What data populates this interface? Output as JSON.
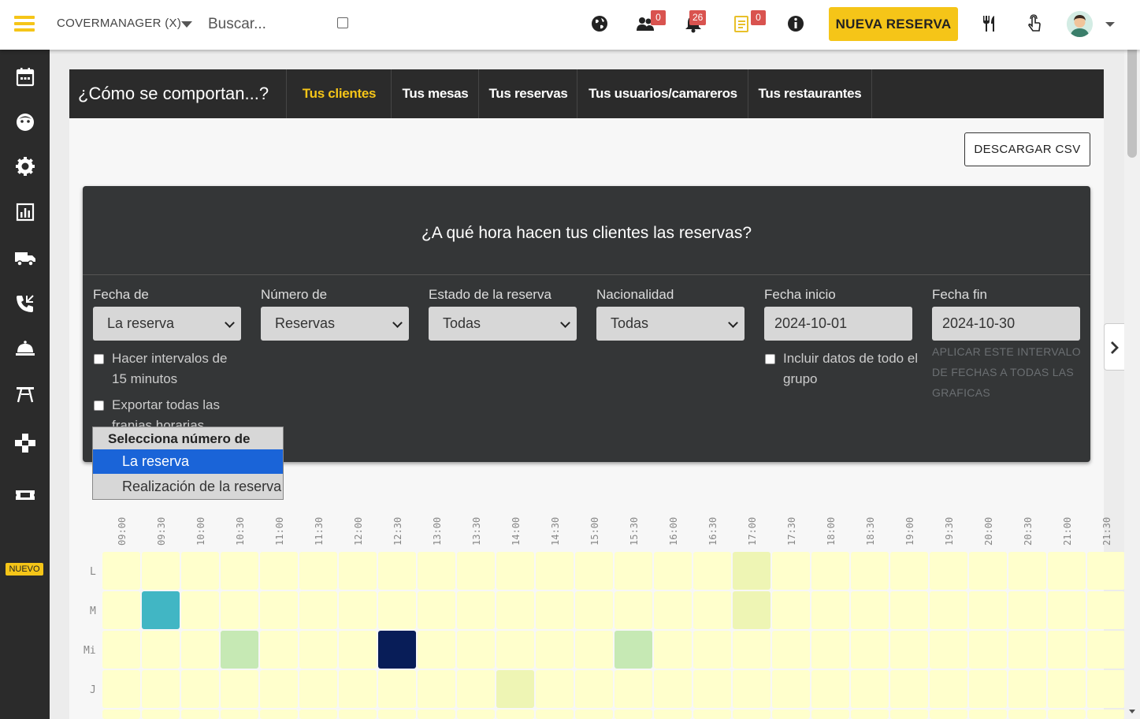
{
  "topbar": {
    "brand": "COVERMANAGER (X)",
    "search_placeholder": "Buscar...",
    "badges": {
      "people": "0",
      "bell": "26",
      "notes": "0"
    },
    "new_reservation": "NUEVA RESERVA"
  },
  "sidebar": {
    "items": [
      "calendar-icon",
      "face-icon",
      "gear-icon",
      "chart-icon",
      "truck-icon",
      "phone-icon",
      "cloche-icon",
      "table-icon",
      "gamepad-icon",
      "ticket-icon"
    ],
    "new_badge": "NUEVO"
  },
  "tabs": {
    "title": "¿Cómo se comportan...?",
    "items": [
      {
        "label": "Tus clientes",
        "active": true
      },
      {
        "label": "Tus mesas",
        "active": false
      },
      {
        "label": "Tus reservas",
        "active": false
      },
      {
        "label": "Tus usuarios/camareros",
        "active": false
      },
      {
        "label": "Tus restaurantes",
        "active": false
      }
    ]
  },
  "download_csv": "DESCARGAR CSV",
  "panel": {
    "title": "¿A qué hora hacen tus clientes las reservas?",
    "filters": {
      "fecha_de": {
        "label": "Fecha de",
        "value": "La reserva"
      },
      "numero_de": {
        "label": "Número de",
        "value": "Reservas"
      },
      "estado": {
        "label": "Estado de la reserva",
        "value": "Todas"
      },
      "nacionalidad": {
        "label": "Nacionalidad",
        "value": "Todas"
      },
      "fecha_inicio": {
        "label": "Fecha inicio",
        "value": "2024-10-01"
      },
      "fecha_fin": {
        "label": "Fecha fin",
        "value": "2024-10-30"
      }
    },
    "checkbox_intervals": "Hacer intervalos de 15 minutos",
    "checkbox_export": "Exportar todas las franjas horarias",
    "checkbox_group": "Incluir datos de todo el grupo",
    "apply_all": "APLICAR ESTE INTERVALO DE FECHAS A TODAS LAS GRAFICAS"
  },
  "dropdown": {
    "header": "Selecciona número de",
    "options": [
      {
        "label": "La reserva",
        "selected": true
      },
      {
        "label": "Realización de la reserva",
        "selected": false
      }
    ]
  },
  "chart_data": {
    "type": "heatmap",
    "x": [
      "09:00",
      "09:30",
      "10:00",
      "10:30",
      "11:00",
      "11:30",
      "12:00",
      "12:30",
      "13:00",
      "13:30",
      "14:00",
      "14:30",
      "15:00",
      "15:30",
      "16:00",
      "16:30",
      "17:00",
      "17:30",
      "18:00",
      "18:30",
      "19:00",
      "19:30",
      "20:00",
      "20:30",
      "21:00",
      "21:30"
    ],
    "y": [
      "L",
      "M",
      "Mi",
      "J"
    ],
    "levels": [
      [
        0,
        0,
        0,
        0,
        0,
        0,
        0,
        0,
        0,
        0,
        0,
        0,
        0,
        0,
        0,
        0,
        1,
        0,
        0,
        0,
        0,
        0,
        0,
        0,
        0,
        0
      ],
      [
        0,
        3,
        0,
        0,
        0,
        0,
        0,
        0,
        0,
        0,
        0,
        0,
        0,
        0,
        0,
        0,
        1,
        0,
        0,
        0,
        0,
        0,
        0,
        0,
        0,
        0
      ],
      [
        0,
        0,
        0,
        2,
        0,
        0,
        0,
        4,
        0,
        0,
        0,
        0,
        0,
        2,
        0,
        0,
        0,
        0,
        0,
        0,
        0,
        0,
        0,
        0,
        0,
        0
      ],
      [
        0,
        0,
        0,
        0,
        0,
        0,
        0,
        0,
        0,
        0,
        1,
        0,
        0,
        0,
        0,
        0,
        0,
        0,
        0,
        0,
        0,
        0,
        0,
        0,
        0,
        0
      ]
    ],
    "colors": [
      "#ffffcc",
      "#eef5b4",
      "#c6e9b4",
      "#41b6c4",
      "#081d58"
    ]
  }
}
